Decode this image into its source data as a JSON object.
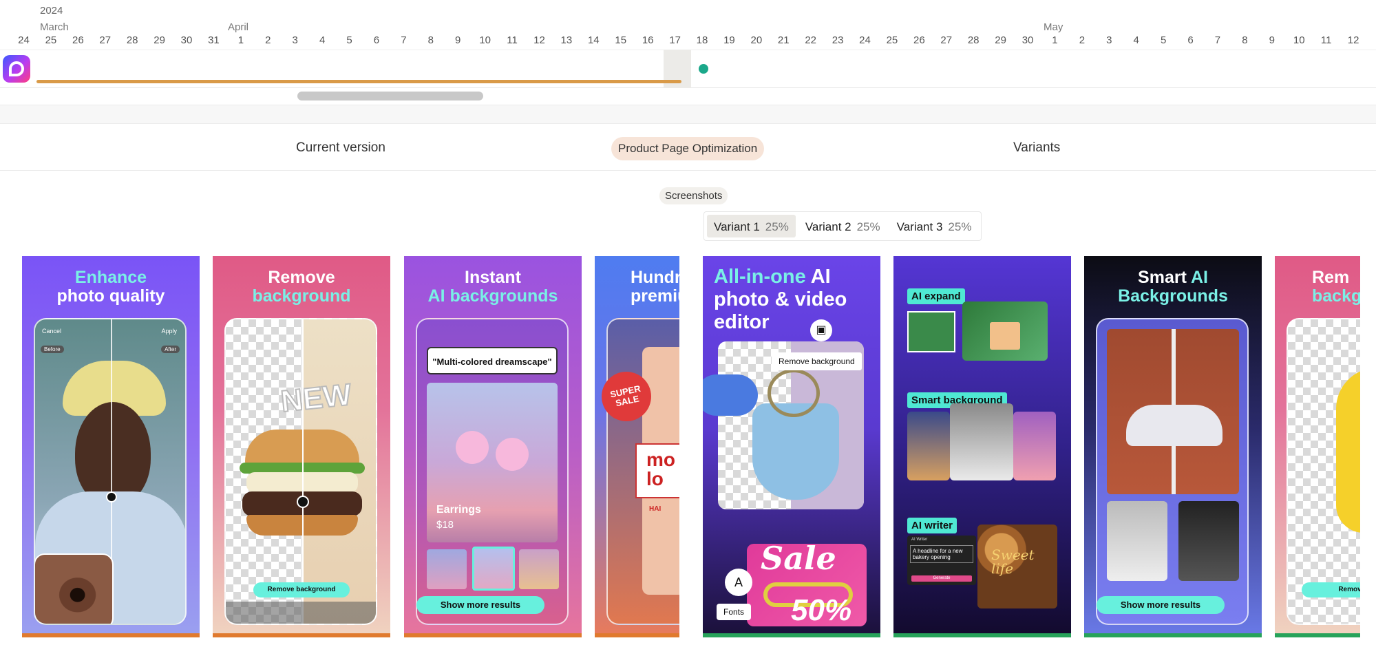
{
  "timeline": {
    "year": "2024",
    "months": {
      "march": "March",
      "april": "April",
      "may": "May"
    },
    "days": [
      "24",
      "25",
      "26",
      "27",
      "28",
      "29",
      "30",
      "31",
      "1",
      "2",
      "3",
      "4",
      "5",
      "6",
      "7",
      "8",
      "9",
      "10",
      "11",
      "12",
      "13",
      "14",
      "15",
      "16",
      "17",
      "18",
      "19",
      "20",
      "21",
      "22",
      "23",
      "24",
      "25",
      "26",
      "27",
      "28",
      "29",
      "30",
      "1",
      "2",
      "3",
      "4",
      "5",
      "6",
      "7",
      "8",
      "9",
      "10",
      "11",
      "12"
    ],
    "bar_color": "#d99a48",
    "dot_color": "#1aa88a"
  },
  "headings": {
    "current": "Current version",
    "pill": "Product Page Optimization",
    "variants": "Variants",
    "screenshots": "Screenshots"
  },
  "variant_tabs": [
    {
      "label": "Variant 1",
      "pct": "25%"
    },
    {
      "label": "Variant 2",
      "pct": "25%"
    },
    {
      "label": "Variant 3",
      "pct": "25%"
    }
  ],
  "current_cards": {
    "c1": {
      "title_hl": "Enhance",
      "title": "photo quality",
      "cancel": "Cancel",
      "apply": "Apply",
      "before": "Before",
      "after": "After"
    },
    "c2": {
      "title": "Remove",
      "title_hl": "background",
      "button": "Remove background",
      "sticker": "NEW"
    },
    "c3": {
      "title": "Instant",
      "title_hl": "AI backgrounds",
      "prompt": "\"Multi-colored dreamscape\"",
      "product": "Earrings",
      "price": "$18",
      "button": "Show more results"
    },
    "c4": {
      "title": "Hundr",
      "title2": "premiu",
      "sticker": "SUPER SALE",
      "text1": "mo",
      "text2": "lo",
      "hair": "HAI"
    }
  },
  "variant_cards": {
    "v1": {
      "title_hl": "All-in-one",
      "title": "AI photo & video editor",
      "tooltip": "Remove background",
      "sale": "Sale",
      "sale_pct": "50%",
      "fonts": "Fonts"
    },
    "v2": {
      "tag1": "AI expand",
      "tag2": "Smart background",
      "tag3": "AI writer",
      "writer_header": "AI Writer",
      "writer_text": "A headline for a new bakery opening",
      "writer_btn": "Generate",
      "sweet": "Sweet life"
    },
    "v3": {
      "title": "Smart",
      "title_hl": "AI",
      "title2": "Backgrounds",
      "button": "Show more results"
    },
    "v4": {
      "title": "Rem",
      "title_hl": "backg",
      "button": "Remov"
    }
  },
  "colors": {
    "left_rail_accent": "#e07a2e",
    "right_rail_accent": "#27a35a"
  }
}
